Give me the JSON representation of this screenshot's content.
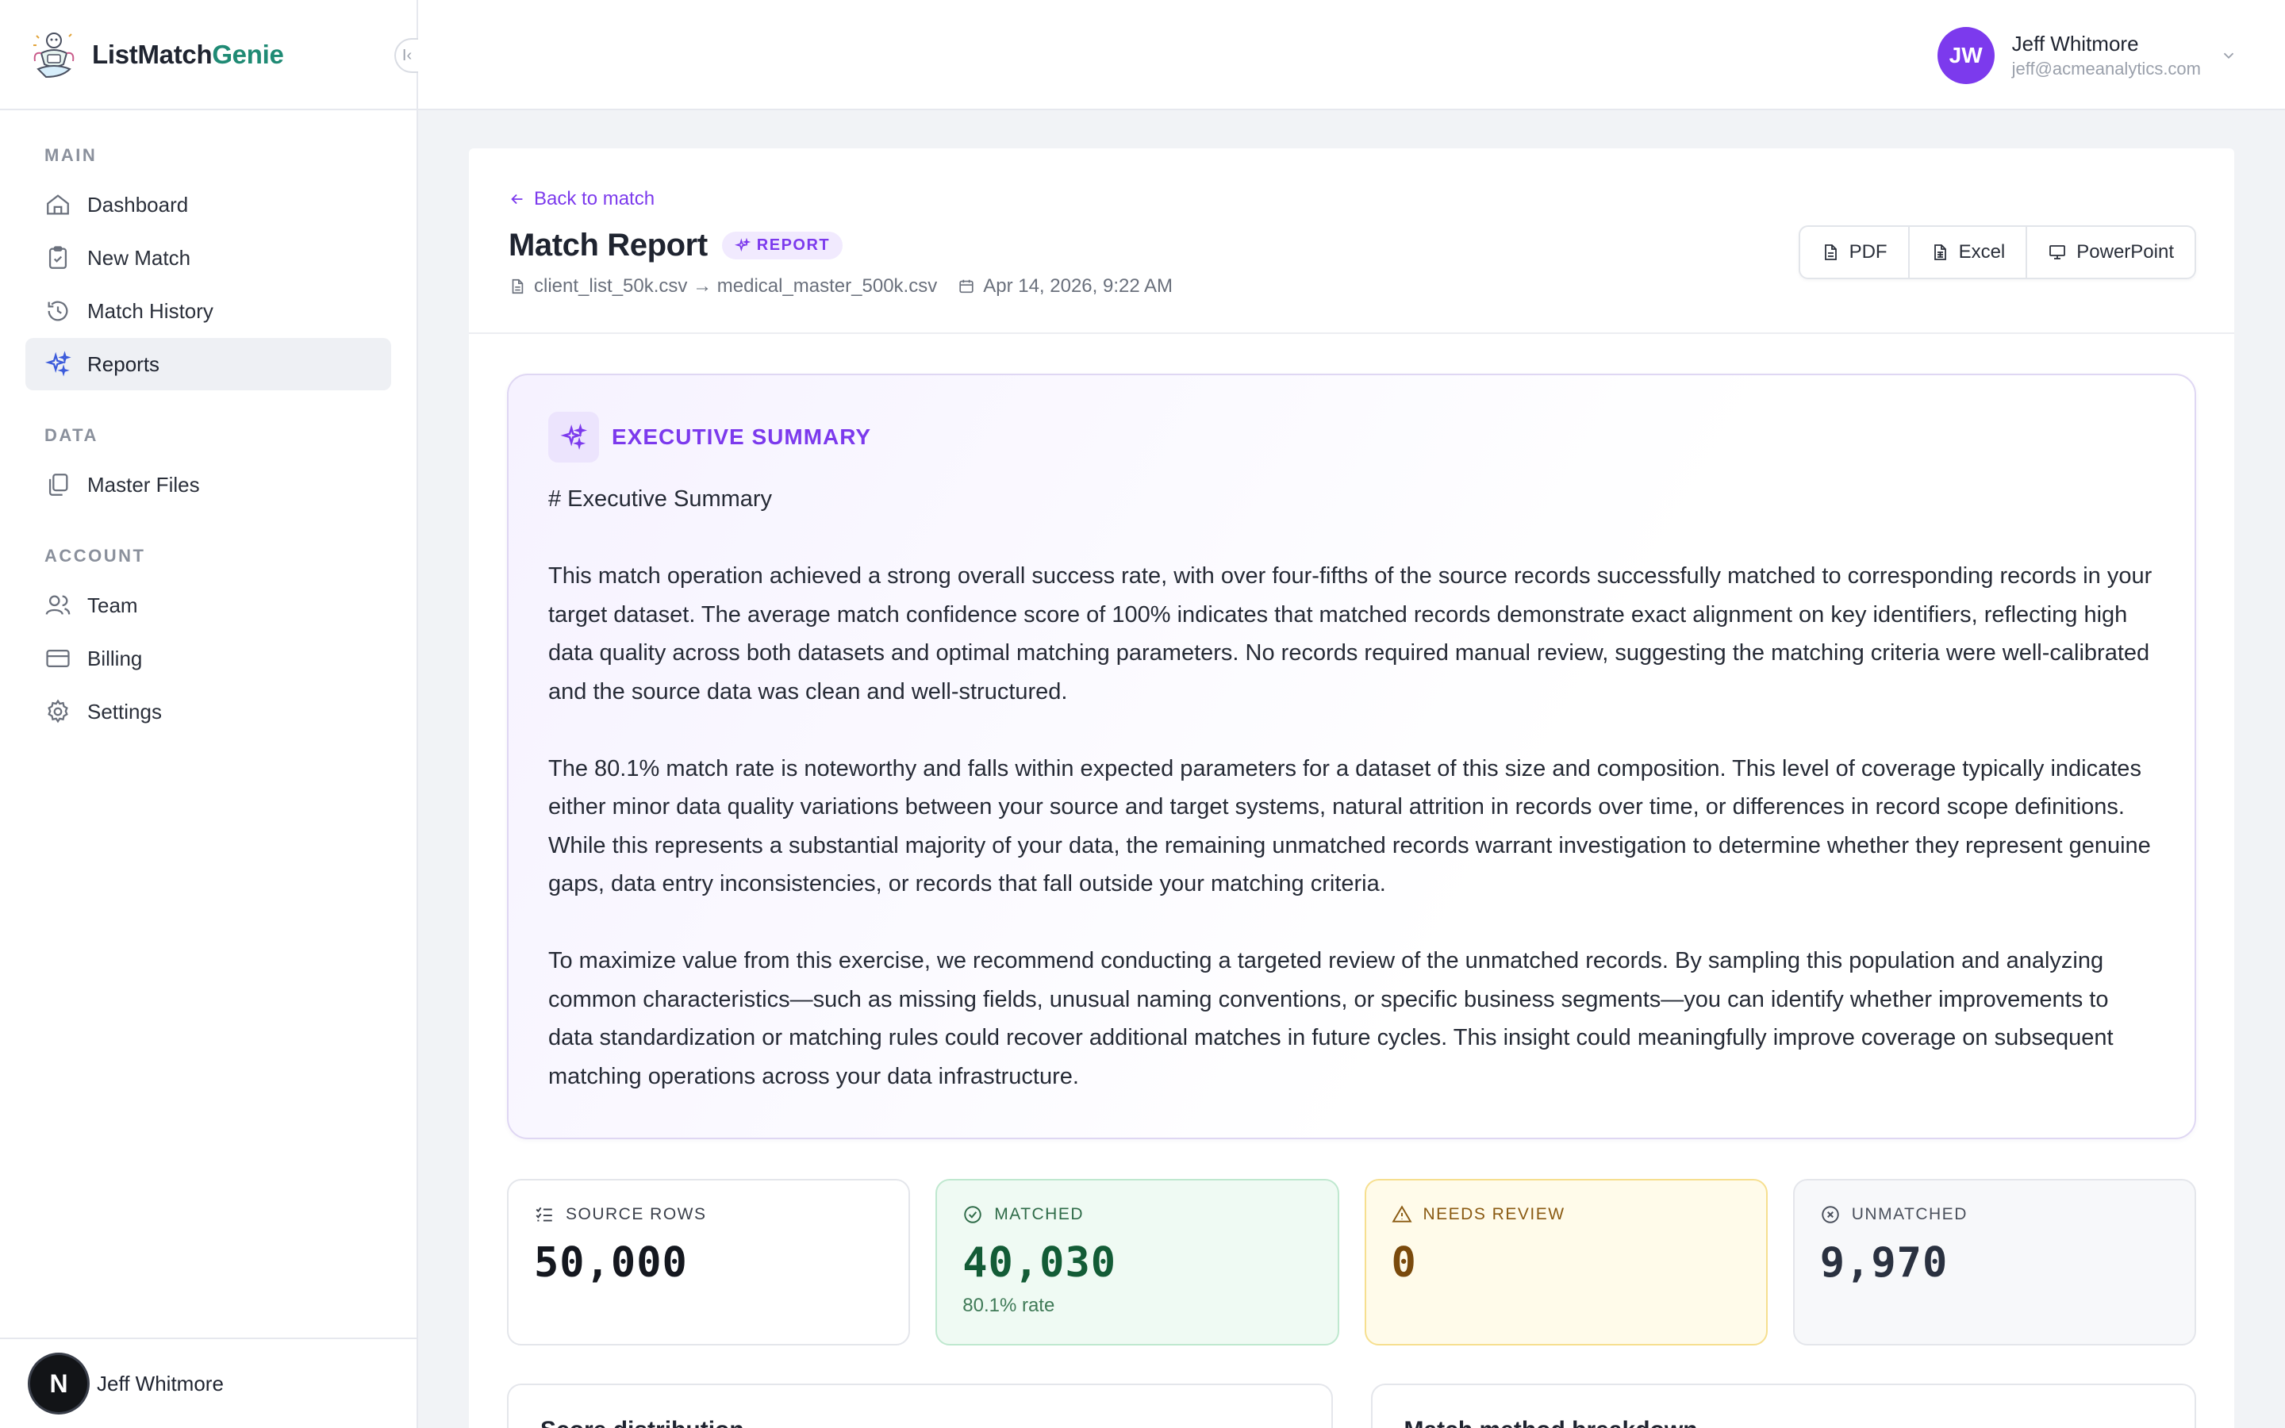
{
  "brand": {
    "name_main": "ListMatch",
    "name_accent": "Genie"
  },
  "sidebar": {
    "sections": [
      {
        "label": "MAIN",
        "items": [
          {
            "label": "Dashboard",
            "icon": "home-icon"
          },
          {
            "label": "New Match",
            "icon": "clipboard-check-icon"
          },
          {
            "label": "Match History",
            "icon": "history-icon"
          },
          {
            "label": "Reports",
            "icon": "sparkles-icon",
            "active": true
          }
        ]
      },
      {
        "label": "DATA",
        "items": [
          {
            "label": "Master Files",
            "icon": "files-icon"
          }
        ]
      },
      {
        "label": "ACCOUNT",
        "items": [
          {
            "label": "Team",
            "icon": "users-icon"
          },
          {
            "label": "Billing",
            "icon": "credit-card-icon"
          },
          {
            "label": "Settings",
            "icon": "gear-icon"
          }
        ]
      }
    ],
    "footer": {
      "avatar_letter": "N",
      "name": "Jeff Whitmore"
    }
  },
  "user": {
    "initials": "JW",
    "name": "Jeff Whitmore",
    "email": "jeff@acmeanalytics.com"
  },
  "report": {
    "back_label": "Back to match",
    "title": "Match Report",
    "badge": "REPORT",
    "files": "client_list_50k.csv → medical_master_500k.csv",
    "date": "Apr 14, 2026, 9:22 AM",
    "exports": [
      "PDF",
      "Excel",
      "PowerPoint"
    ]
  },
  "summary": {
    "title": "EXECUTIVE SUMMARY",
    "heading": "# Executive Summary",
    "paragraphs": [
      "This match operation achieved a strong overall success rate, with over four-fifths of the source records successfully matched to corresponding records in your target dataset. The average match confidence score of 100% indicates that matched records demonstrate exact alignment on key identifiers, reflecting high data quality across both datasets and optimal matching parameters. No records required manual review, suggesting the matching criteria were well-calibrated and the source data was clean and well-structured.",
      "The 80.1% match rate is noteworthy and falls within expected parameters for a dataset of this size and composition. This level of coverage typically indicates either minor data quality variations between your source and target systems, natural attrition in records over time, or differences in record scope definitions. While this represents a substantial majority of your data, the remaining unmatched records warrant investigation to determine whether they represent genuine gaps, data entry inconsistencies, or records that fall outside your matching criteria.",
      "To maximize value from this exercise, we recommend conducting a targeted review of the unmatched records. By sampling this population and analyzing common characteristics—such as missing fields, unusual naming conventions, or specific business segments—you can identify whether improvements to data standardization or matching rules could recover additional matches in future cycles. This insight could meaningfully improve coverage on subsequent matching operations across your data infrastructure."
    ]
  },
  "stats": {
    "source": {
      "label": "SOURCE ROWS",
      "value": "50,000"
    },
    "matched": {
      "label": "MATCHED",
      "value": "40,030",
      "sub": "80.1% rate"
    },
    "review": {
      "label": "NEEDS REVIEW",
      "value": "0"
    },
    "unmatched": {
      "label": "UNMATCHED",
      "value": "9,970"
    }
  },
  "bottom": {
    "left_title": "Score distribution",
    "right_title": "Match method breakdown"
  },
  "colors": {
    "accent": "#7c3aed",
    "brand_green": "#1f8a74"
  }
}
